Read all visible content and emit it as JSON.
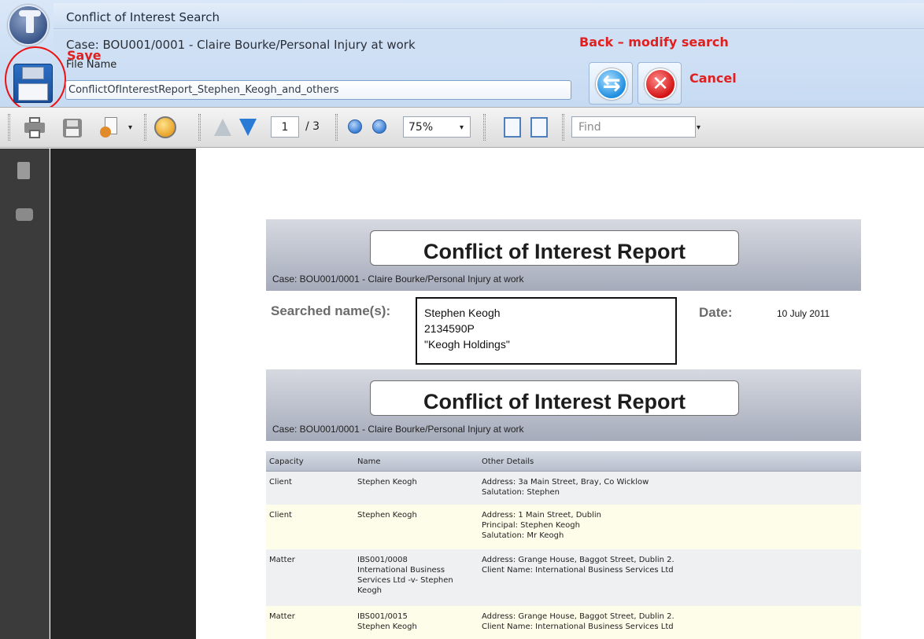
{
  "window": {
    "title": "Conflict of Interest Search",
    "case_line": "Case: BOU001/0001 - Claire Bourke/Personal Injury at work"
  },
  "save_section": {
    "annotation": "Save",
    "file_name_label": "File Name",
    "file_name_value": "ConflictOfInterestReport_Stephen_Keogh_and_others"
  },
  "actions": {
    "back_annotation": "Back – modify search",
    "cancel_annotation": "Cancel",
    "back_glyph": "⇆",
    "cancel_glyph": "✕"
  },
  "toolbar": {
    "page_current": "1",
    "page_total": "/ 3",
    "zoom": "75%",
    "find_placeholder": "Find",
    "dropdown_glyph": "▾",
    "icons": [
      "printer-icon",
      "save-disk-icon",
      "export-icon",
      "refresh-icon",
      "page-up-icon",
      "page-down-icon",
      "zoom-out-icon",
      "zoom-in-icon",
      "fit-width-icon",
      "fit-page-icon"
    ]
  },
  "report": {
    "title": "Conflict of Interest Report",
    "case_line": "Case: BOU001/0001 - Claire Bourke/Personal Injury at work",
    "searched_label": "Searched name(s):",
    "searched_names": [
      "Stephen Keogh",
      "2134590P",
      "\"Keogh Holdings\""
    ],
    "date_label": "Date:",
    "date_value": "10 July 2011",
    "section_title": "Conflict of Interest Report",
    "section_case_line": "Case: BOU001/0001 - Claire Bourke/Personal Injury at work",
    "table": {
      "columns": [
        "Capacity",
        "Name",
        "Other Details"
      ],
      "rows": [
        {
          "capacity": "Client",
          "name": [
            "Stephen Keogh"
          ],
          "details": [
            "Address: 3a Main Street, Bray, Co Wicklow",
            "Salutation: Stephen"
          ]
        },
        {
          "capacity": "Client",
          "name": [
            "Stephen Keogh"
          ],
          "details": [
            "Address: 1 Main Street, Dublin",
            "Principal: Stephen Keogh",
            "Salutation: Mr Keogh"
          ]
        },
        {
          "capacity": "Matter",
          "name": [
            "IBS001/0008",
            "International Business",
            "Services Ltd -v- Stephen",
            "Keogh"
          ],
          "details": [
            "Address: Grange House, Baggot Street, Dublin 2.",
            "Client Name: International Business Services Ltd"
          ]
        },
        {
          "capacity": "Matter",
          "name": [
            "IBS001/0015",
            "Stephen Keogh"
          ],
          "details": [
            "Address: Grange House, Baggot Street, Dublin 2.",
            "Client Name: International Business Services Ltd"
          ]
        }
      ]
    }
  },
  "colors": {
    "annotation_red": "#e01f1f",
    "header_blue": "#cfe0f5",
    "row_even": "#eff0f2",
    "row_odd": "#fefde9",
    "dark_panel": "#252525"
  }
}
